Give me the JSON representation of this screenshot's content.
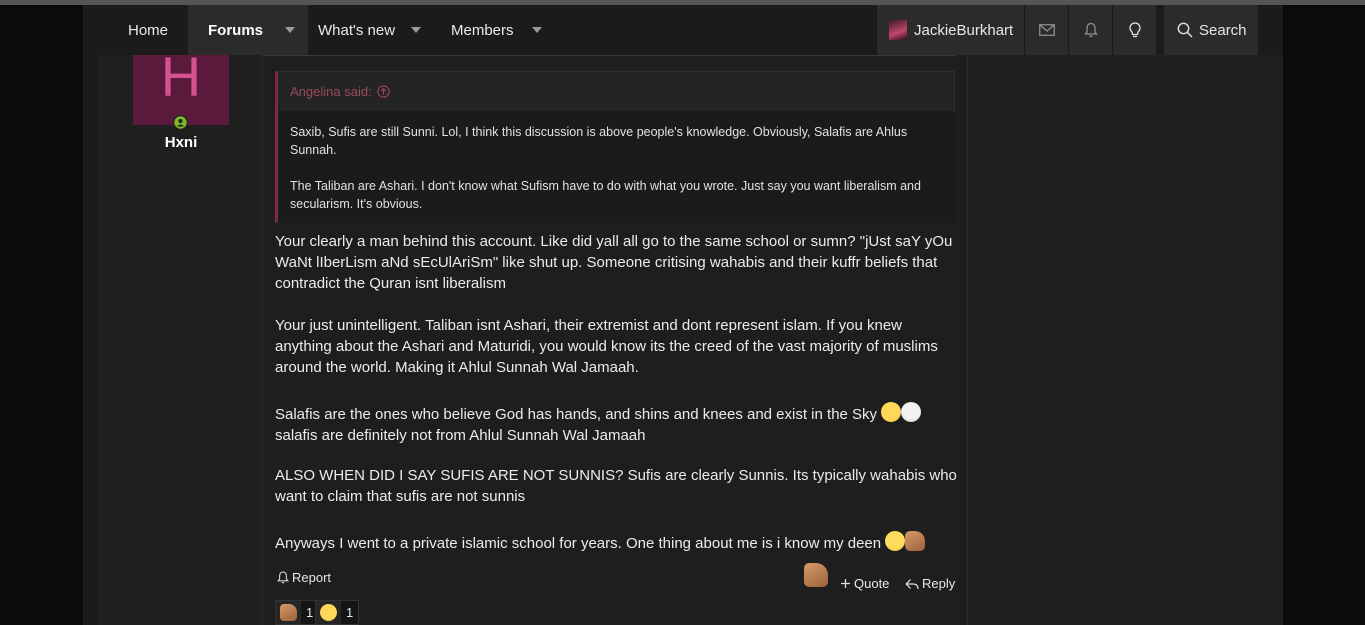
{
  "nav": {
    "home": "Home",
    "forums": "Forums",
    "whats_new": "What's new",
    "members": "Members",
    "username": "JackieBurkhart",
    "search": "Search"
  },
  "post": {
    "author": "Hxni",
    "avatar_letter": "H",
    "quote": {
      "author_label": "Angelina said:",
      "p1": "Saxib, Sufis are still Sunni. Lol, I think this discussion is above people's knowledge. Obviously, Salafis are Ahlus Sunnah.",
      "p2": "The Taliban are Ashari. I don't know what Sufism have to do with what you wrote. Just say you want liberalism and secularism. It's obvious."
    },
    "paragraphs": {
      "p1": "Your clearly a man behind this account. Like did yall all go to the same school or sumn? \"jUst saY yOu WaNt lIberLism aNd sEcUlAriSm\" like shut up. Someone critising wahabis and their kuffr beliefs that contradict the Quran isnt liberalism",
      "p2": "Your just unintelligent. Taliban isnt Ashari, their extremist and dont represent islam. If you knew anything about the Ashari and Maturidi, you would know its the creed of the vast majority of muslims around the world. Making it Ahlul Sunnah Wal Jamaah.",
      "p3a": "Salafis are the ones who believe God has hands, and shins and knees and exist in the Sky ",
      "p3b": "salafis are definitely not from Ahlul Sunnah Wal Jamaah",
      "p4": "ALSO WHEN DID I SAY SUFIS ARE NOT SUNNIS? Sufis are clearly Sunnis. Its typically wahabis who want to claim that sufis are not sunnis",
      "p5": "Anyways I went to a private islamic school for years. One thing about me is i know my deen "
    },
    "actions": {
      "report": "Report",
      "quote": "Quote",
      "reply": "Reply"
    },
    "reactions": [
      {
        "icon": "thumbs-up-icon",
        "count": "1"
      },
      {
        "icon": "laughing-face-icon",
        "count": "1"
      }
    ]
  },
  "colors": {
    "accent": "#7b2a3f",
    "avatar_bg": "#5b1a3c",
    "online": "#7fb82a"
  }
}
